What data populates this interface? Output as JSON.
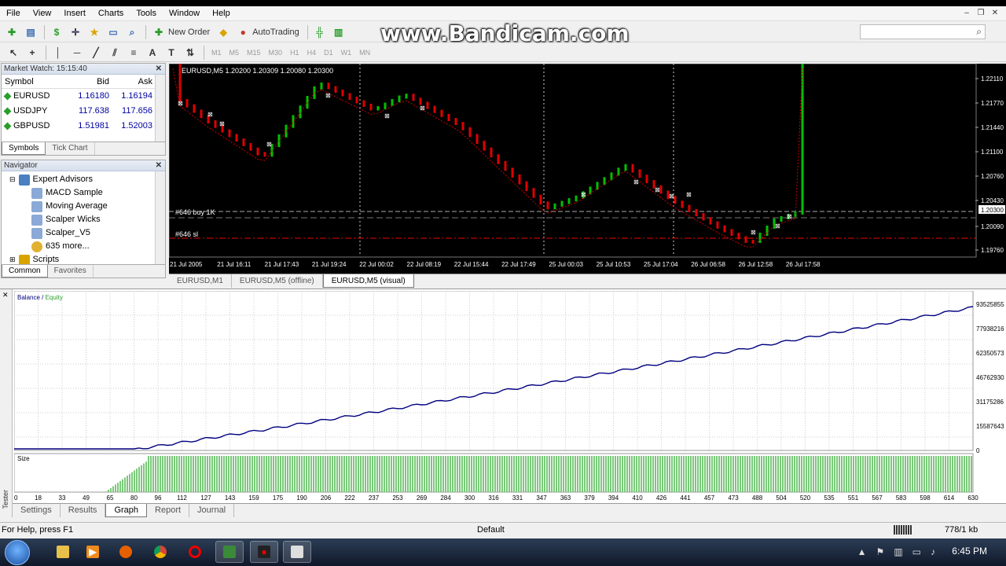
{
  "menu": [
    "File",
    "View",
    "Insert",
    "Charts",
    "Tools",
    "Window",
    "Help"
  ],
  "toolbar": {
    "new_order": "New Order",
    "autotrading": "AutoTrading"
  },
  "timeframes": [
    "M1",
    "M5",
    "M15",
    "M30",
    "H1",
    "H4",
    "D1",
    "W1",
    "MN"
  ],
  "watermark": "www.Bandicam.com",
  "market_watch": {
    "title": "Market Watch: 15:15:40",
    "headers": {
      "symbol": "Symbol",
      "bid": "Bid",
      "ask": "Ask"
    },
    "rows": [
      {
        "symbol": "EURUSD",
        "bid": "1.16180",
        "ask": "1.16194"
      },
      {
        "symbol": "USDJPY",
        "bid": "117.638",
        "ask": "117.656"
      },
      {
        "symbol": "GBPUSD",
        "bid": "1.51981",
        "ask": "1.52003"
      }
    ],
    "tabs": [
      "Symbols",
      "Tick Chart"
    ]
  },
  "navigator": {
    "title": "Navigator",
    "root": "Expert Advisors",
    "items": [
      "MACD Sample",
      "Moving Average",
      "Scalper Wicks",
      "Scalper_V5",
      "635 more..."
    ],
    "scripts": "Scripts",
    "tabs": [
      "Common",
      "Favorites"
    ]
  },
  "chart": {
    "header": "EURUSD,M5  1.20200 1.20309 1.20080 1.20300",
    "buy_label": "#646 buy 1K",
    "sl_label": "#646 sl",
    "price_ticks": [
      "1.22110",
      "1.21770",
      "1.21440",
      "1.21100",
      "1.20760",
      "1.20430",
      "1.20300",
      "1.20090",
      "1.19760"
    ],
    "current_price": "1.20300",
    "time_ticks": [
      "21 Jul 2005",
      "21 Jul 16:11",
      "21 Jul 17:43",
      "21 Jul 19:24",
      "22 Jul 00:02",
      "22 Jul 08:19",
      "22 Jul 15:44",
      "22 Jul 17:49",
      "25 Jul 00:03",
      "25 Jul 10:53",
      "25 Jul 17:04",
      "26 Jul 06:58",
      "26 Jul 12:58",
      "26 Jul 17:58"
    ],
    "tabs": [
      "EURUSD,M1",
      "EURUSD,M5 (offline)",
      "EURUSD,M5 (visual)"
    ]
  },
  "tester": {
    "side_label": "Tester",
    "legend_balance": "Balance",
    "legend_sep": " / ",
    "legend_equity": "Equity",
    "size_label": "Size",
    "y_ticks": [
      "93525855",
      "77938216",
      "62350573",
      "46762930",
      "31175286",
      "15587643",
      "0"
    ],
    "x_ticks": [
      "0",
      "18",
      "33",
      "49",
      "65",
      "80",
      "96",
      "112",
      "127",
      "143",
      "159",
      "175",
      "190",
      "206",
      "222",
      "237",
      "253",
      "269",
      "284",
      "300",
      "316",
      "331",
      "347",
      "363",
      "379",
      "394",
      "410",
      "426",
      "441",
      "457",
      "473",
      "488",
      "504",
      "520",
      "535",
      "551",
      "567",
      "583",
      "598",
      "614",
      "630"
    ],
    "tabs": [
      "Settings",
      "Results",
      "Graph",
      "Report",
      "Journal"
    ]
  },
  "status": {
    "help": "For Help, press F1",
    "profile": "Default",
    "traffic": "778/1 kb"
  },
  "clock": "6:45 PM"
}
